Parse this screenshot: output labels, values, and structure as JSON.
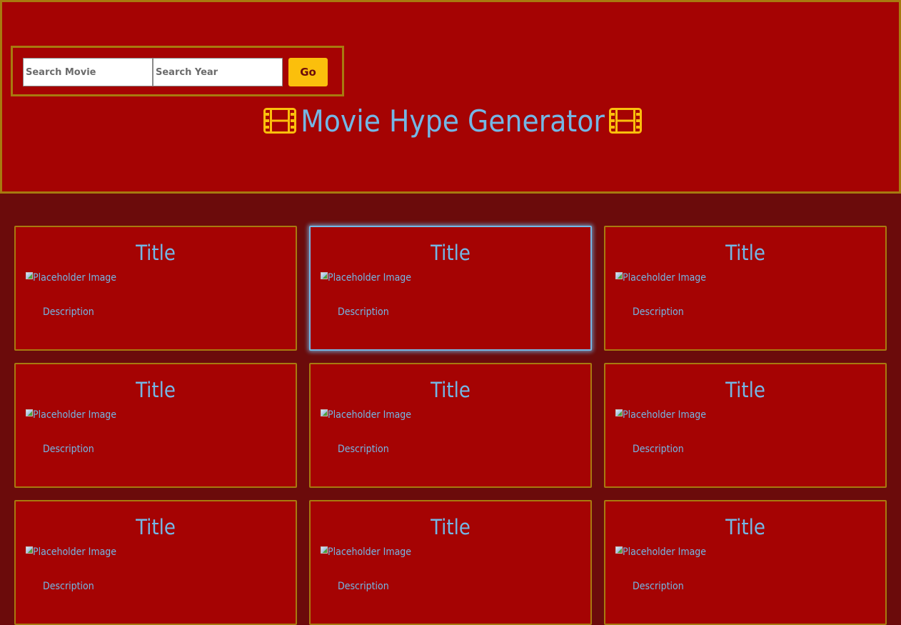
{
  "search": {
    "movie_placeholder": "Search Movie",
    "year_placeholder": "Search Year",
    "go_label": "Go"
  },
  "header": {
    "title": "Movie Hype Generator"
  },
  "colors": {
    "header_bg": "#a50303",
    "page_bg": "#6b0b0b",
    "border_gold": "#a87a0f",
    "accent_yellow": "#fbbf0c",
    "text_blue": "#74b7e5"
  },
  "icons": {
    "title_left": "film-frames-icon",
    "title_right": "film-frames-icon"
  },
  "cards": [
    {
      "title": "Title",
      "image_alt": "Placeholder Image",
      "description": "Description",
      "selected": false
    },
    {
      "title": "Title",
      "image_alt": "Placeholder Image",
      "description": "Description",
      "selected": true
    },
    {
      "title": "Title",
      "image_alt": "Placeholder Image",
      "description": "Description",
      "selected": false
    },
    {
      "title": "Title",
      "image_alt": "Placeholder Image",
      "description": "Description",
      "selected": false
    },
    {
      "title": "Title",
      "image_alt": "Placeholder Image",
      "description": "Description",
      "selected": false
    },
    {
      "title": "Title",
      "image_alt": "Placeholder Image",
      "description": "Description",
      "selected": false
    },
    {
      "title": "Title",
      "image_alt": "Placeholder Image",
      "description": "Description",
      "selected": false
    },
    {
      "title": "Title",
      "image_alt": "Placeholder Image",
      "description": "Description",
      "selected": false
    },
    {
      "title": "Title",
      "image_alt": "Placeholder Image",
      "description": "Description",
      "selected": false
    }
  ]
}
